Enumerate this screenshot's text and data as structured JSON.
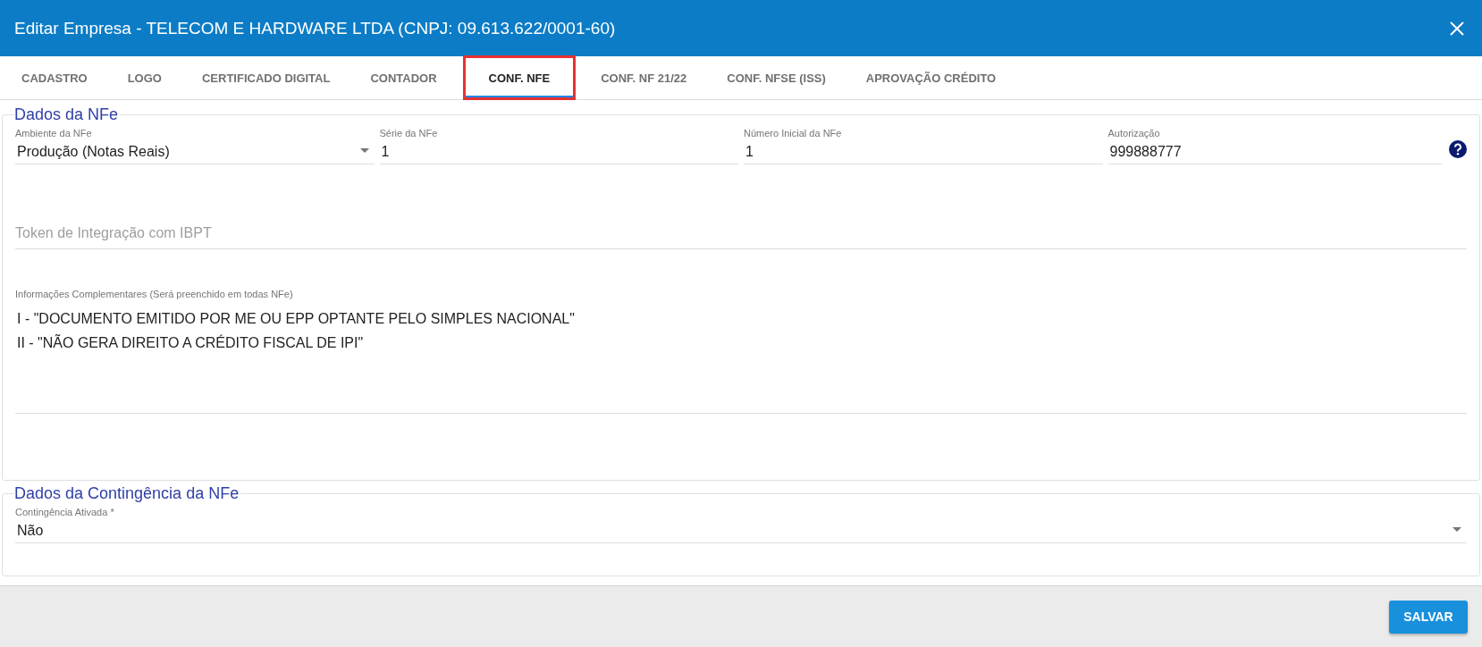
{
  "window": {
    "title": "Editar Empresa - TELECOM E HARDWARE LTDA (CNPJ: 09.613.622/0001-60)"
  },
  "tabs": [
    {
      "label": "CADASTRO",
      "selected": false
    },
    {
      "label": "LOGO",
      "selected": false
    },
    {
      "label": "CERTIFICADO DIGITAL",
      "selected": false
    },
    {
      "label": "CONTADOR",
      "selected": false
    },
    {
      "label": "CONF. NFE",
      "selected": true
    },
    {
      "label": "CONF. NF 21/22",
      "selected": false
    },
    {
      "label": "CONF. NFSE (ISS)",
      "selected": false
    },
    {
      "label": "APROVAÇÃO CRÉDITO",
      "selected": false
    }
  ],
  "nfe_section": {
    "title": "Dados da NFe",
    "fields": [
      {
        "kind": "select",
        "label": "Ambiente da NFe",
        "value": "Produção (Notas Reais)"
      },
      {
        "kind": "text",
        "label": "Série da NFe",
        "value": "1"
      },
      {
        "kind": "text",
        "label": "Número Inicial da NFe",
        "value": "1"
      },
      {
        "kind": "help",
        "label": "Autorização",
        "value": "999888777"
      }
    ],
    "token": {
      "placeholder": "Token de Integração com IBPT"
    },
    "info": {
      "label": "Informações Complementares (Será preenchido em todas NFe)",
      "lines": [
        "I - \"DOCUMENTO EMITIDO POR ME OU EPP OPTANTE PELO SIMPLES NACIONAL\"",
        "II - \"NÃO GERA DIREITO A CRÉDITO FISCAL DE IPI\""
      ]
    }
  },
  "contingency_section": {
    "title": "Dados da Contingência da NFe",
    "field": {
      "label": "Contingência Ativada *",
      "value": "Não"
    }
  },
  "buttons": [
    "SALVAR"
  ]
}
